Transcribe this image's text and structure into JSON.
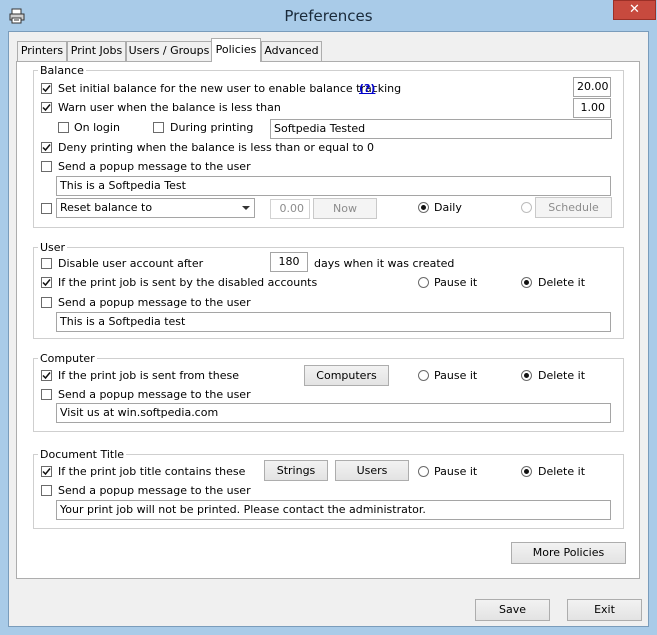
{
  "window": {
    "title": "Preferences",
    "close_glyph": "✕",
    "app_icon": "printer-icon"
  },
  "tabs": [
    {
      "label": "Printers"
    },
    {
      "label": "Print Jobs"
    },
    {
      "label": "Users / Groups"
    },
    {
      "label": "Policies",
      "active": true
    },
    {
      "label": "Advanced"
    }
  ],
  "balance": {
    "group_label": "Balance",
    "initial_balance": {
      "label": "Set initial balance for the new user to enable balance tracking",
      "help_link": "(?)",
      "value": "20.00",
      "checked": true
    },
    "warn": {
      "label": "Warn user when the balance is less than",
      "value": "1.00",
      "checked": true
    },
    "on_login": {
      "label": "On login",
      "checked": false
    },
    "during_printing": {
      "label": "During printing",
      "checked": false
    },
    "warn_text": "Softpedia Tested",
    "deny": {
      "label": "Deny printing when the balance is less than or equal to 0",
      "checked": true
    },
    "popup": {
      "label": "Send a popup message to the user",
      "checked": false,
      "message": "This is a Softpedia Test"
    },
    "reset": {
      "checked": false,
      "selected": "Reset balance to",
      "value": "0.00",
      "now_label": "Now",
      "daily_label": "Daily",
      "daily_selected": true,
      "schedule_label": "Schedule"
    }
  },
  "user": {
    "group_label": "User",
    "disable": {
      "label": "Disable user account after",
      "days": "180",
      "suffix": "days when it was created",
      "checked": false
    },
    "disabled_jobs": {
      "label": "If the print job is sent by the disabled accounts",
      "checked": true,
      "pause_label": "Pause it",
      "delete_label": "Delete it",
      "selected": "delete"
    },
    "popup": {
      "label": "Send a popup message to the user",
      "checked": false,
      "message": "This is a Softpedia test"
    }
  },
  "computer": {
    "group_label": "Computer",
    "sent_from": {
      "label": "If the print job is sent from these",
      "checked": true,
      "button": "Computers",
      "pause_label": "Pause it",
      "delete_label": "Delete it",
      "selected": "delete"
    },
    "popup": {
      "label": "Send a popup message to the user",
      "checked": false,
      "message": "Visit us at win.softpedia.com"
    }
  },
  "document_title": {
    "group_label": "Document Title",
    "contains": {
      "label": "If the print job title contains these",
      "checked": true,
      "strings_button": "Strings",
      "users_button": "Users",
      "pause_label": "Pause it",
      "delete_label": "Delete it",
      "selected": "delete"
    },
    "popup": {
      "label": "Send a popup message to the user",
      "checked": false,
      "message": "Your print job will not be printed. Please contact the administrator."
    }
  },
  "more_policies_label": "More Policies",
  "footer": {
    "save_label": "Save",
    "exit_label": "Exit"
  }
}
